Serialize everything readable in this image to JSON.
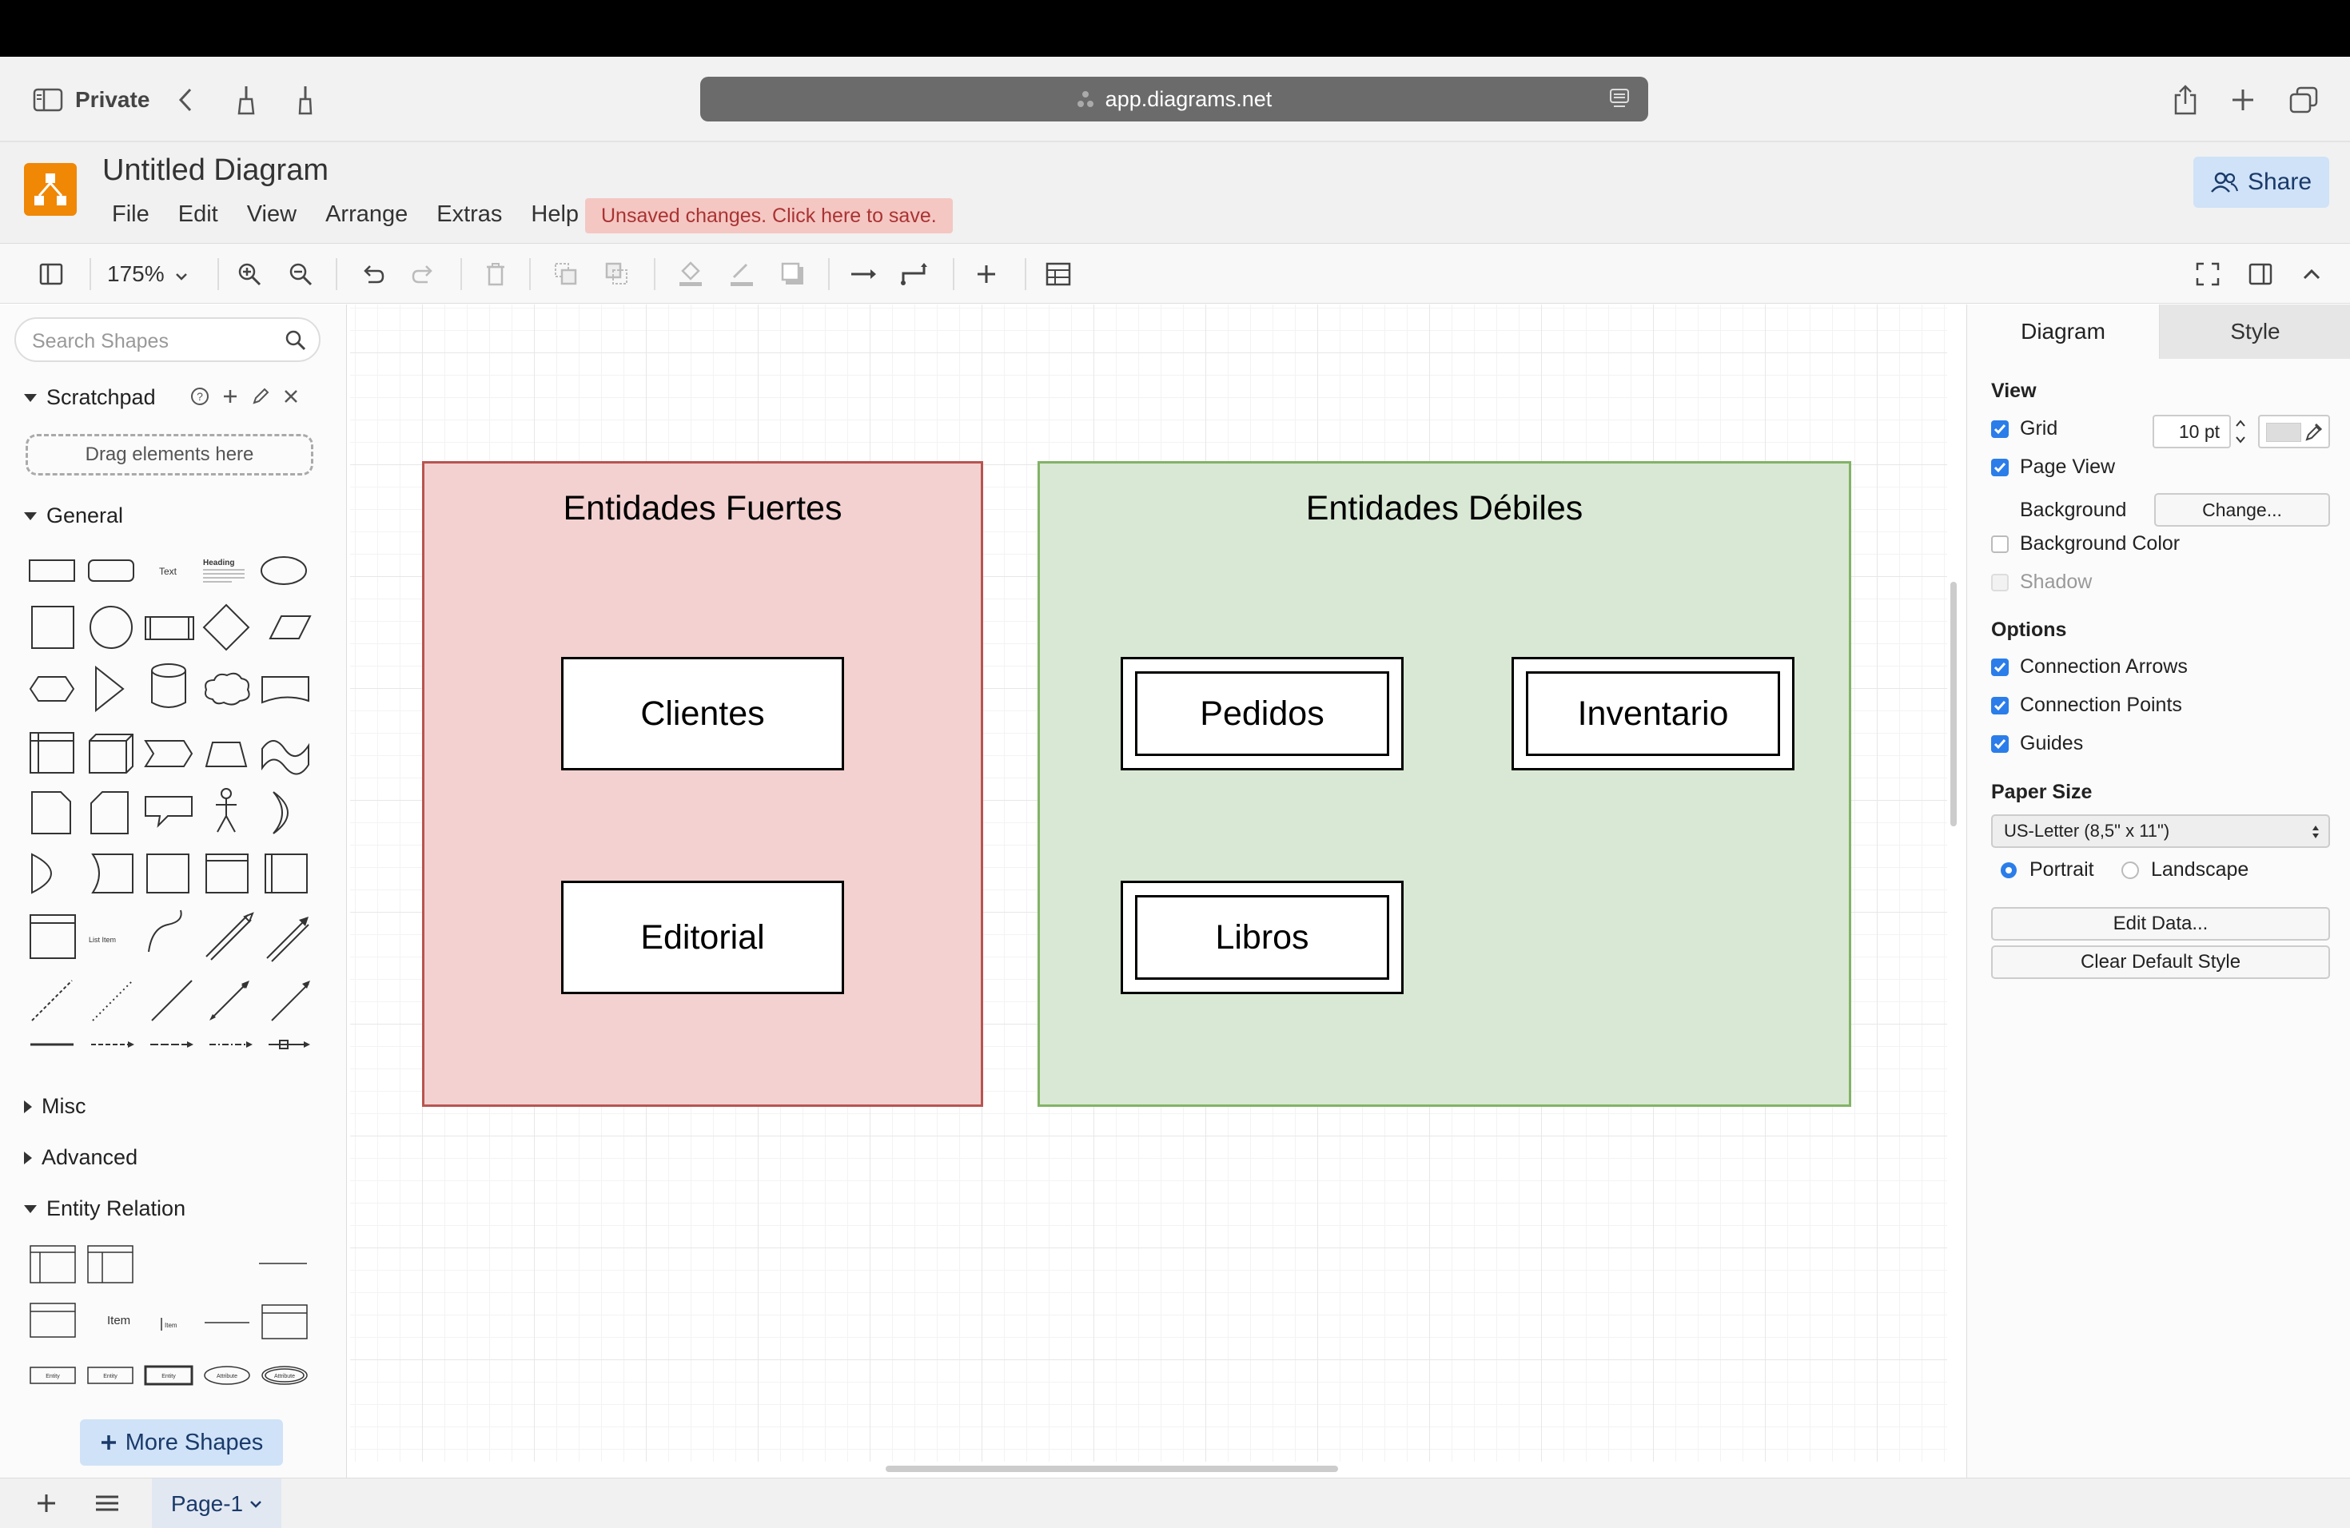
{
  "browser": {
    "private_label": "Private",
    "url": "app.diagrams.net"
  },
  "app": {
    "title": "Untitled Diagram",
    "menu": [
      "File",
      "Edit",
      "View",
      "Arrange",
      "Extras",
      "Help"
    ],
    "unsaved_notice": "Unsaved changes. Click here to save.",
    "share_label": "Share",
    "brand_color": "#f08705"
  },
  "toolbar": {
    "zoom": "175%"
  },
  "sidebar": {
    "search_placeholder": "Search Shapes",
    "scratchpad": {
      "title": "Scratchpad",
      "drop_hint": "Drag elements here"
    },
    "sections": {
      "general": "General",
      "misc": "Misc",
      "advanced": "Advanced",
      "entity_relation": "Entity Relation"
    },
    "shape_labels": {
      "text": "Text",
      "heading": "Heading",
      "list_item": "List Item",
      "item": "Item",
      "entity": "Entity",
      "attribute": "Attribute"
    },
    "more_shapes": "More Shapes"
  },
  "diagram": {
    "strong_container": {
      "title": "Entidades Fuertes",
      "fill": "#f2d1d0",
      "stroke": "#b85450",
      "entities": [
        "Clientes",
        "Editorial"
      ]
    },
    "weak_container": {
      "title": "Entidades Débiles",
      "fill": "#d9e8d4",
      "stroke": "#82b366",
      "entities": [
        "Pedidos",
        "Inventario",
        "Libros"
      ]
    }
  },
  "format_panel": {
    "tabs": [
      "Diagram",
      "Style"
    ],
    "view_heading": "View",
    "grid_label": "Grid",
    "grid_size": "10 pt",
    "page_view_label": "Page View",
    "background_label": "Background",
    "change_button": "Change...",
    "background_color_label": "Background Color",
    "shadow_label": "Shadow",
    "options_heading": "Options",
    "connection_arrows": "Connection Arrows",
    "connection_points": "Connection Points",
    "guides": "Guides",
    "paper_size_heading": "Paper Size",
    "paper_size": "US-Letter (8,5\" x 11\")",
    "portrait": "Portrait",
    "landscape": "Landscape",
    "edit_data": "Edit Data...",
    "clear_default_style": "Clear Default Style",
    "accent": "#2b7de9"
  },
  "pages": {
    "current": "Page-1"
  }
}
